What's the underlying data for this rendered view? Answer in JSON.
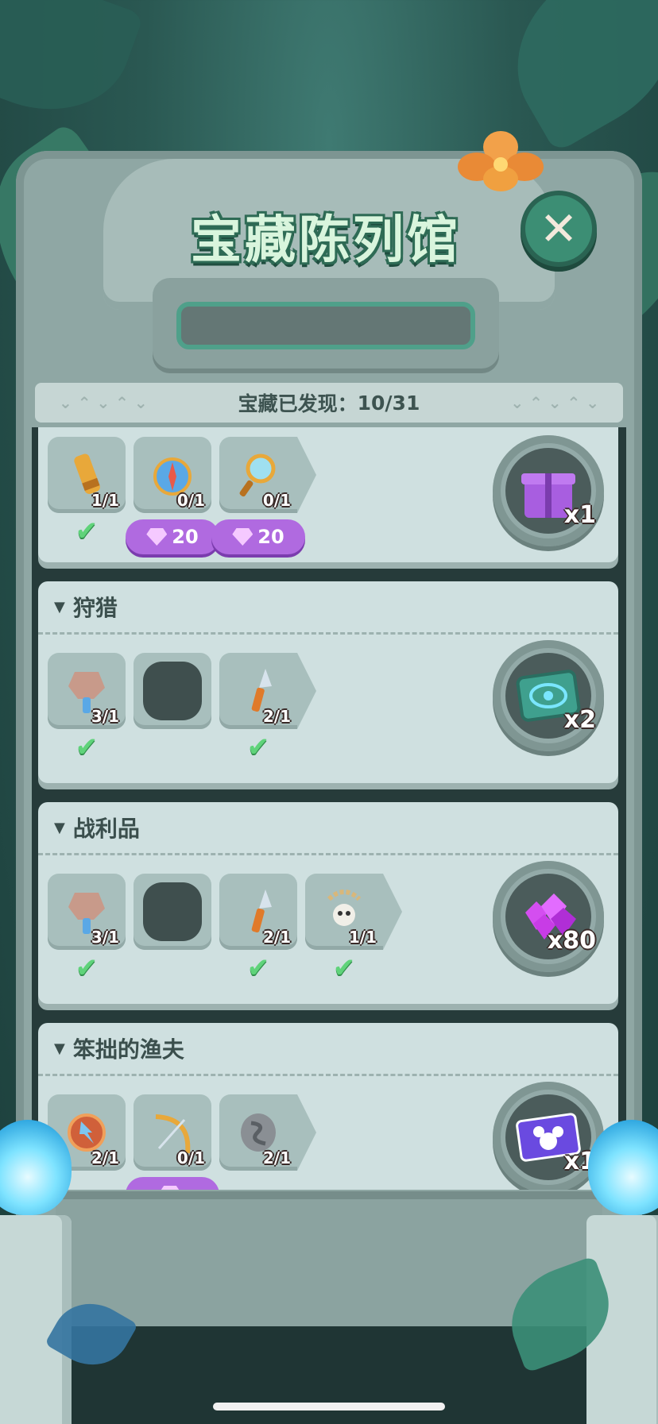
{
  "header": {
    "title": "宝藏陈列馆",
    "close_icon": "close-icon"
  },
  "progress": {
    "label": "宝藏已发现：",
    "value": "10/31"
  },
  "cards": [
    {
      "title": "",
      "items": [
        {
          "icon": "spyglass-icon",
          "count": "1/1",
          "found": true,
          "gem_cost": null
        },
        {
          "icon": "compass-icon",
          "count": "0/1",
          "found": false,
          "gem_cost": "20"
        },
        {
          "icon": "magnifier-icon",
          "count": "0/1",
          "found": false,
          "gem_cost": "20"
        }
      ],
      "reward": {
        "icon": "gift-box-icon",
        "qty": "x1"
      }
    },
    {
      "title": "狩猎",
      "items": [
        {
          "icon": "stone-hammer-icon",
          "count": "3/1",
          "found": true,
          "gem_cost": null
        },
        {
          "icon": "locked-item-icon",
          "count": "",
          "found": false,
          "gem_cost": null
        },
        {
          "icon": "spear-icon",
          "count": "2/1",
          "found": true,
          "gem_cost": null
        }
      ],
      "reward": {
        "icon": "eye-ticket-icon",
        "qty": "x2"
      }
    },
    {
      "title": "战利品",
      "items": [
        {
          "icon": "stone-hammer-icon",
          "count": "3/1",
          "found": true,
          "gem_cost": null
        },
        {
          "icon": "locked-item-icon",
          "count": "",
          "found": false,
          "gem_cost": null
        },
        {
          "icon": "spear-icon",
          "count": "2/1",
          "found": true,
          "gem_cost": null
        },
        {
          "icon": "skull-necklace-icon",
          "count": "1/1",
          "found": true,
          "gem_cost": null
        }
      ],
      "reward": {
        "icon": "purple-gems-icon",
        "qty": "x80"
      }
    },
    {
      "title": "笨拙的渔夫",
      "items": [
        {
          "icon": "arrow-shield-icon",
          "count": "2/1",
          "found": true,
          "gem_cost": null
        },
        {
          "icon": "bow-icon",
          "count": "0/1",
          "found": false,
          "gem_cost": ""
        },
        {
          "icon": "snake-stone-icon",
          "count": "2/1",
          "found": true,
          "gem_cost": null
        }
      ],
      "reward": {
        "icon": "mickey-card-icon",
        "qty": "x1"
      }
    }
  ],
  "colors": {
    "accent_green": "#3c8e74",
    "check_green": "#5fd37a",
    "gem_purple": "#b06ae0",
    "card_bg": "#cfe0e0"
  }
}
